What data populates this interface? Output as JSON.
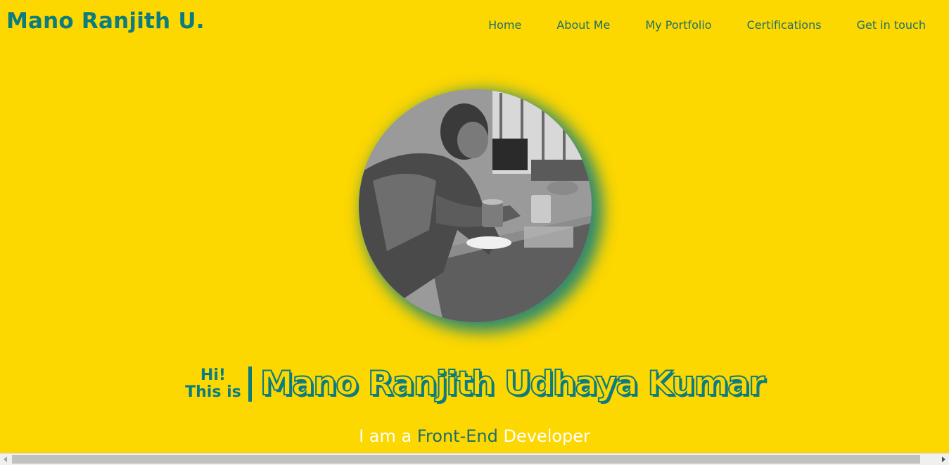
{
  "header": {
    "logo": "Mano Ranjith U.",
    "nav": [
      "Home",
      "About Me",
      "My Portfolio",
      "Certifications",
      "Get in touch"
    ]
  },
  "hero": {
    "greeting_line1": "Hi!",
    "greeting_line2": "This is",
    "name": "Mano Ranjith Udhaya Kumar",
    "tagline_prefix": "I am a ",
    "tagline_role": "Front-End",
    "tagline_suffix": " Developer"
  },
  "colors": {
    "background": "#FCD700",
    "accent": "#0B7C80",
    "nav_text": "#1E6E6E",
    "tagline_text": "#FFFFFF"
  }
}
